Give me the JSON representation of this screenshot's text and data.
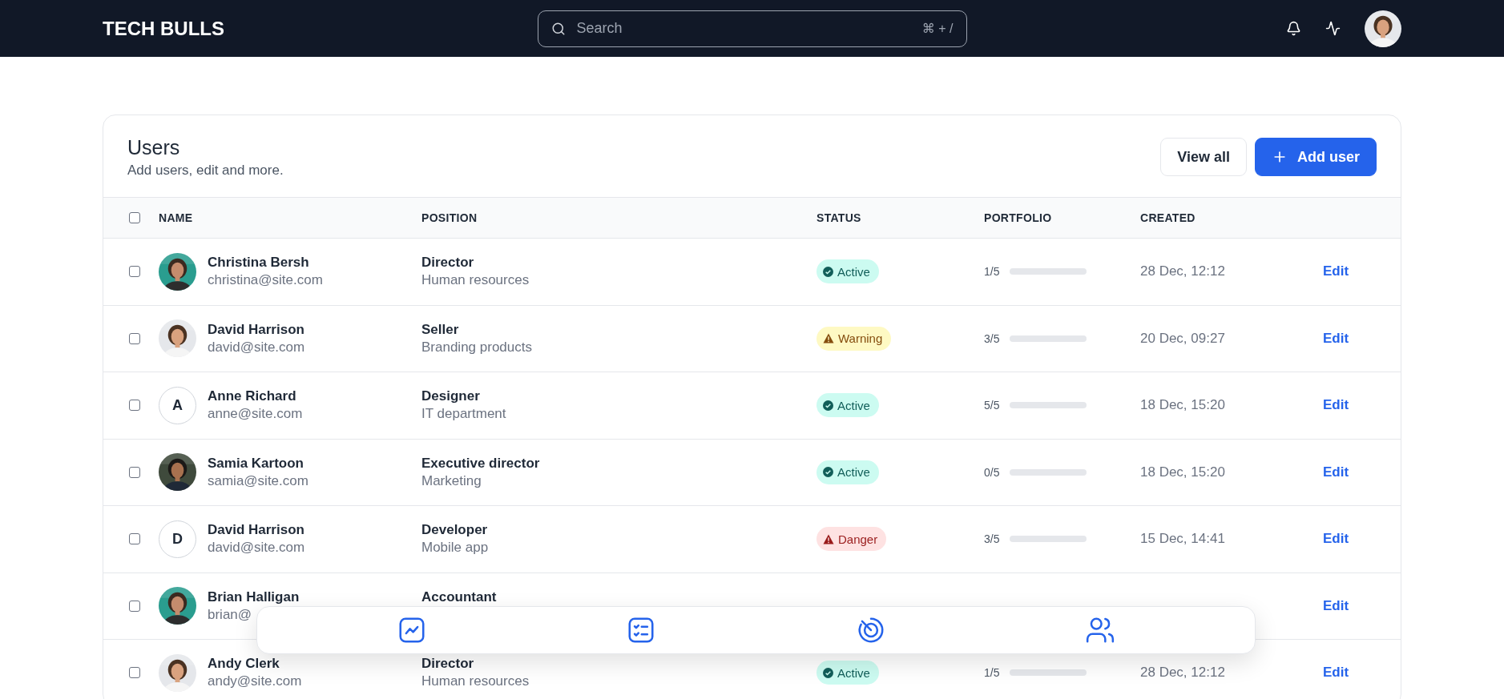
{
  "header": {
    "logo": "TECH BULLS",
    "search": {
      "placeholder": "Search",
      "shortcut": "⌘ + /"
    }
  },
  "card": {
    "title": "Users",
    "subtitle": "Add users, edit and more.",
    "buttons": [
      {
        "kind": "secondary",
        "label": "View all"
      },
      {
        "kind": "primary",
        "label": "Add user"
      }
    ]
  },
  "table": {
    "select_all": {
      "checked": false
    },
    "columns": [
      "NAME",
      "POSITION",
      "STATUS",
      "PORTFOLIO",
      "CREATED"
    ],
    "rows": [
      {
        "checked": false,
        "name": "Christina Bersh",
        "email": "christina@site.com",
        "position": "Director",
        "department": "Human resources",
        "status": {
          "kind": "active",
          "label": "Active"
        },
        "portfolio": "1/5",
        "created": "28 Dec, 12:12",
        "action": "Edit"
      },
      {
        "checked": false,
        "name": "David Harrison",
        "email": "david@site.com",
        "position": "Seller",
        "department": "Branding products",
        "status": {
          "kind": "warning",
          "label": "Warning"
        },
        "portfolio": "3/5",
        "created": "20 Dec, 09:27",
        "action": "Edit"
      },
      {
        "checked": false,
        "avatar": {
          "kind": "initial",
          "initial": "A"
        },
        "name": "Anne Richard",
        "email": "anne@site.com",
        "position": "Designer",
        "department": "IT department",
        "status": {
          "kind": "active",
          "label": "Active"
        },
        "portfolio": "5/5",
        "created": "18 Dec, 15:20",
        "action": "Edit"
      },
      {
        "checked": false,
        "name": "Samia Kartoon",
        "email": "samia@site.com",
        "position": "Executive director",
        "department": "Marketing",
        "status": {
          "kind": "active",
          "label": "Active"
        },
        "portfolio": "0/5",
        "created": "18 Dec, 15:20",
        "action": "Edit"
      },
      {
        "checked": false,
        "avatar": {
          "kind": "initial",
          "initial": "D"
        },
        "name": "David Harrison",
        "email": "david@site.com",
        "position": "Developer",
        "department": "Mobile app",
        "status": {
          "kind": "danger",
          "label": "Danger"
        },
        "portfolio": "3/5",
        "created": "15 Dec, 14:41",
        "action": "Edit"
      },
      {
        "checked": false,
        "name": "Brian Halligan",
        "email": "brian@",
        "position": "Accountant",
        "action": "Edit"
      },
      {
        "checked": false,
        "name": "Andy Clerk",
        "email": "andy@site.com",
        "position": "Director",
        "department": "Human resources",
        "status": {
          "kind": "active",
          "label": "Active"
        },
        "portfolio": "1/5",
        "created": "28 Dec, 12:12",
        "action": "Edit"
      }
    ]
  },
  "dock": {
    "items": [
      {
        "kind": "chart"
      },
      {
        "kind": "tasks"
      },
      {
        "kind": "target"
      },
      {
        "kind": "users"
      }
    ]
  }
}
